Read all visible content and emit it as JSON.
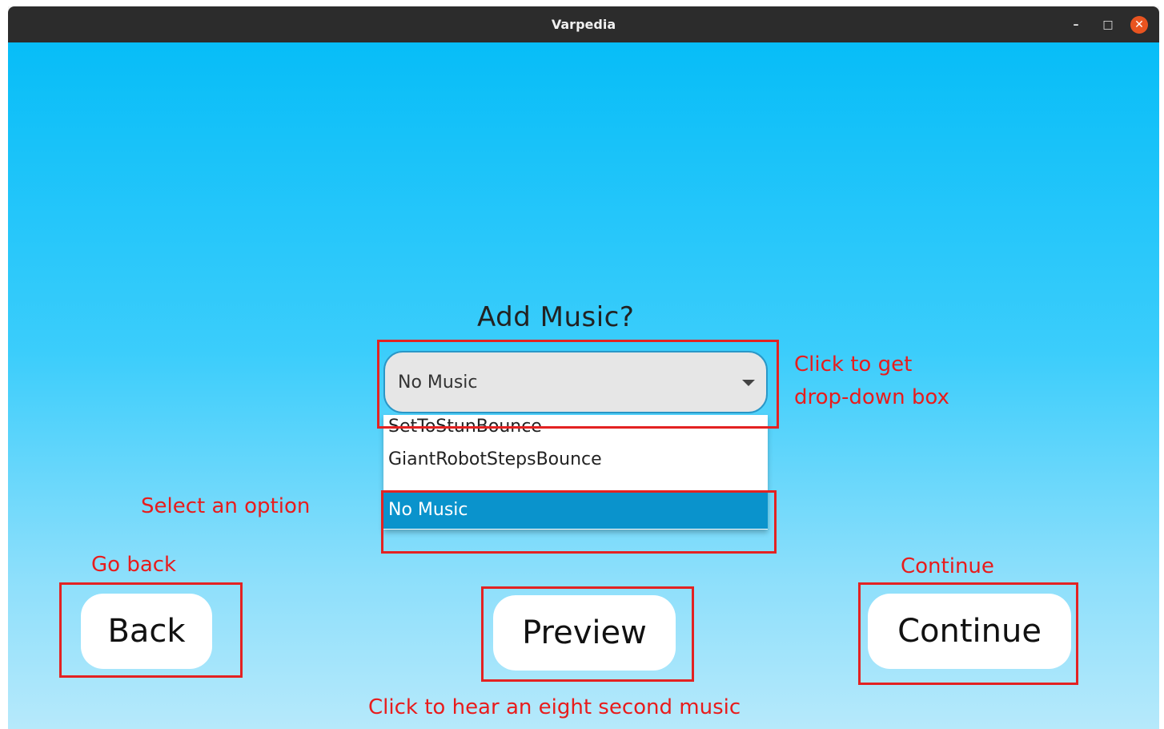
{
  "window": {
    "title": "Varpedia",
    "controls": {
      "minimize": "–",
      "maximize": "□",
      "close": "✕"
    }
  },
  "main": {
    "heading": "Add Music?",
    "music_select": {
      "selected": "No Music",
      "options": [
        "SetToStunBounce",
        "GiantRobotStepsBounce",
        "No Music"
      ],
      "highlighted_index": 2
    },
    "buttons": {
      "back": "Back",
      "preview": "Preview",
      "continue": "Continue"
    }
  },
  "annotations": {
    "dropdown_hint_line1": "Click to get",
    "dropdown_hint_line2": "drop-down box",
    "select_hint": "Select an option",
    "back_hint": "Go back",
    "continue_hint": "Continue",
    "preview_hint": "Click to hear an eight second music",
    "color": "#e32222"
  },
  "colors": {
    "titlebar": "#2c2c2c",
    "close_button": "#e95420",
    "background_top": "#07bdf8",
    "background_bottom": "#b6e9fb",
    "highlight": "#0a93cc"
  }
}
